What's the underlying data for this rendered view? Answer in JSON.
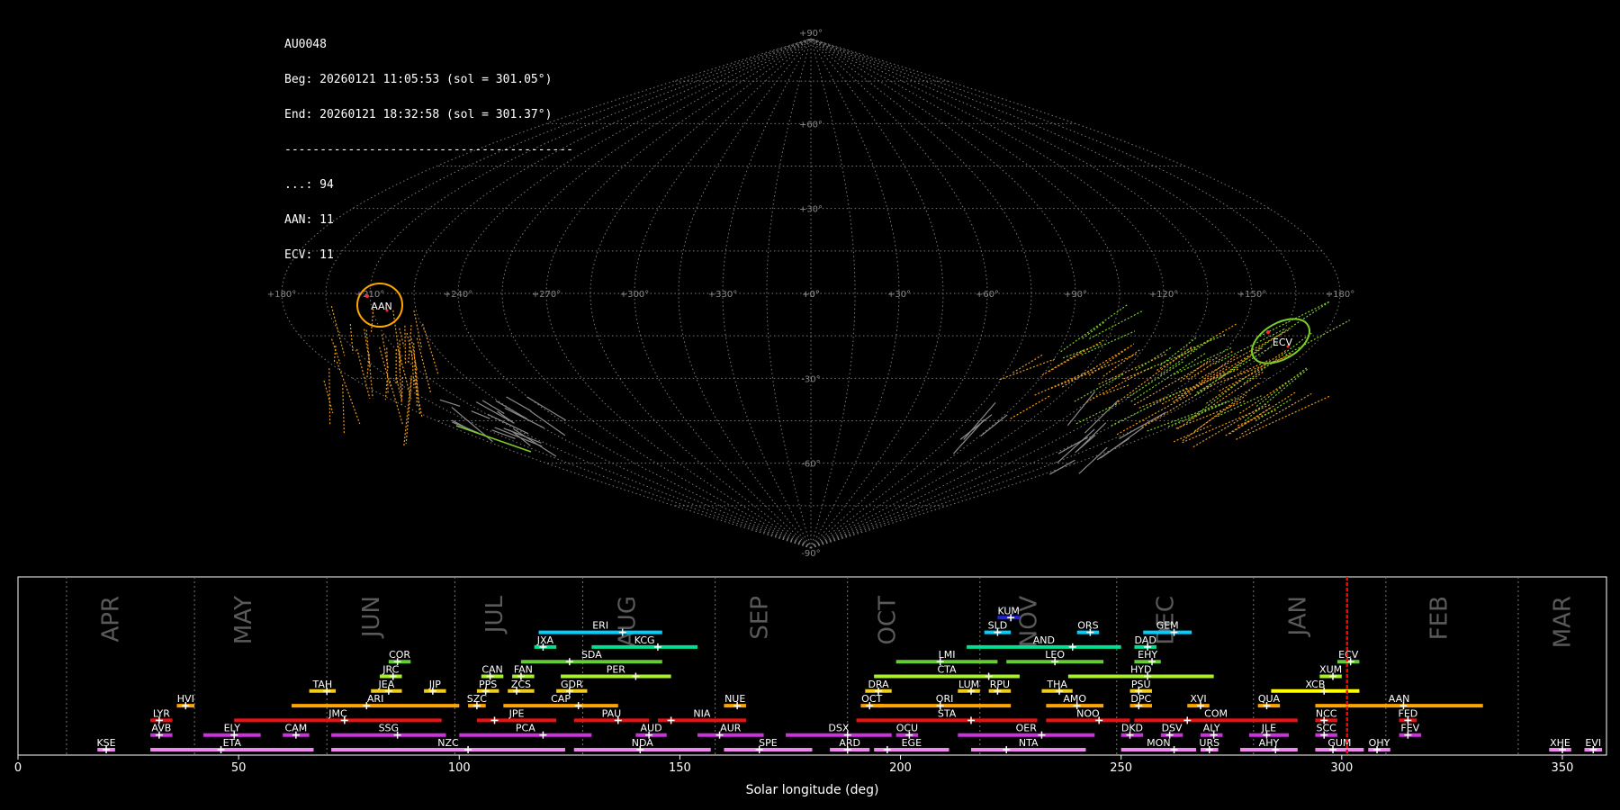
{
  "info": {
    "station": "AU0048",
    "beg": "Beg: 20260121 11:05:53 (sol = 301.05°)",
    "end": "End: 20260121 18:32:58 (sol = 301.37°)",
    "sep": "-----------------------------------------",
    "counts": [
      {
        "label": "...: 94"
      },
      {
        "label": "AAN: 11"
      },
      {
        "label": "ECV: 11"
      }
    ]
  },
  "chart_data": [
    {
      "type": "scatter",
      "projection": "sinusoidal",
      "grid": true,
      "lon_tick_labels": [
        "+180°",
        "+150°",
        "+120°",
        "+90°",
        "+60°",
        "+30°",
        "+0°",
        "+330°",
        "+300°",
        "+270°",
        "+240°",
        "+210°",
        "+180°"
      ],
      "lat_tick_labels": [
        "+90°",
        "+60°",
        "+30°",
        "+0°",
        "-30°",
        "-60°",
        "-90°"
      ],
      "radiants": [
        {
          "name": "AAN",
          "lon": 165,
          "lat": -5,
          "color": "#ffa500"
        },
        {
          "name": "ECV",
          "lon": 206,
          "lat": -17,
          "color": "#7ccd2a"
        }
      ]
    },
    {
      "type": "bar",
      "xlabel": "Solar longitude (deg)",
      "xlim": [
        0,
        360
      ],
      "xticks": [
        0,
        50,
        100,
        150,
        200,
        250,
        300,
        350
      ],
      "current_sol": 301.2,
      "months": [
        {
          "name": "APR",
          "boundary": 11,
          "center": 24
        },
        {
          "name": "MAY",
          "boundary": 40,
          "center": 54
        },
        {
          "name": "JUN",
          "boundary": 70,
          "center": 83
        },
        {
          "name": "JUL",
          "boundary": 99,
          "center": 111
        },
        {
          "name": "AUG",
          "boundary": 128,
          "center": 141
        },
        {
          "name": "SEP",
          "boundary": 158,
          "center": 171
        },
        {
          "name": "OCT",
          "boundary": 188,
          "center": 200
        },
        {
          "name": "NOV",
          "boundary": 218,
          "center": 232
        },
        {
          "name": "DEC",
          "boundary": 249,
          "center": 263
        },
        {
          "name": "JAN",
          "boundary": 280,
          "center": 293
        },
        {
          "name": "FEB",
          "boundary": 310,
          "center": 325
        },
        {
          "name": "MAR",
          "boundary": 340,
          "center": 353
        }
      ],
      "showers": [
        {
          "code": "KUM",
          "start": 222,
          "end": 227,
          "peak": 225,
          "row": 9,
          "color": "#2222dd"
        },
        {
          "code": "ERI",
          "start": 118,
          "end": 146,
          "peak": 137,
          "row": 8,
          "color": "#00d0ff"
        },
        {
          "code": "SLD",
          "start": 219,
          "end": 225,
          "peak": 222,
          "row": 8,
          "color": "#00d0ff"
        },
        {
          "code": "ORS",
          "start": 240,
          "end": 245,
          "peak": 243,
          "row": 8,
          "color": "#00d0ff"
        },
        {
          "code": "GEM",
          "start": 255,
          "end": 266,
          "peak": 262,
          "row": 8,
          "color": "#00d0ff"
        },
        {
          "code": "JXA",
          "start": 117,
          "end": 122,
          "peak": 119,
          "row": 7,
          "color": "#00e090"
        },
        {
          "code": "KCG",
          "start": 130,
          "end": 154,
          "peak": 145,
          "row": 7,
          "color": "#00e090"
        },
        {
          "code": "AND",
          "start": 215,
          "end": 250,
          "peak": 239,
          "row": 7,
          "color": "#00e090"
        },
        {
          "code": "DAD",
          "start": 253,
          "end": 258,
          "peak": 256,
          "row": 7,
          "color": "#00e090"
        },
        {
          "code": "COR",
          "start": 84,
          "end": 89,
          "peak": 86,
          "row": 6,
          "color": "#66cc33"
        },
        {
          "code": "SDA",
          "start": 114,
          "end": 146,
          "peak": 125,
          "row": 6,
          "color": "#66cc33"
        },
        {
          "code": "LMI",
          "start": 199,
          "end": 222,
          "peak": 209,
          "row": 6,
          "color": "#66cc33"
        },
        {
          "code": "LEO",
          "start": 224,
          "end": 246,
          "peak": 235,
          "row": 6,
          "color": "#66cc33"
        },
        {
          "code": "EHY",
          "start": 253,
          "end": 259,
          "peak": 257,
          "row": 6,
          "color": "#66cc33"
        },
        {
          "code": "ECV",
          "start": 299,
          "end": 304,
          "peak": 302,
          "row": 6,
          "color": "#66cc33"
        },
        {
          "code": "JRC",
          "start": 82,
          "end": 87,
          "peak": 85,
          "row": 5,
          "color": "#aaee33"
        },
        {
          "code": "CAN",
          "start": 105,
          "end": 110,
          "peak": 107,
          "row": 5,
          "color": "#aaee33"
        },
        {
          "code": "FAN",
          "start": 112,
          "end": 117,
          "peak": 114,
          "row": 5,
          "color": "#aaee33"
        },
        {
          "code": "PER",
          "start": 123,
          "end": 148,
          "peak": 140,
          "row": 5,
          "color": "#aaee33"
        },
        {
          "code": "CTA",
          "start": 194,
          "end": 227,
          "peak": 220,
          "row": 5,
          "color": "#aaee33"
        },
        {
          "code": "HYD",
          "start": 238,
          "end": 271,
          "peak": 256,
          "row": 5,
          "color": "#aaee33"
        },
        {
          "code": "XUM",
          "start": 295,
          "end": 300,
          "peak": 298,
          "row": 5,
          "color": "#aaee33"
        },
        {
          "code": "TAH",
          "start": 66,
          "end": 72,
          "peak": 70,
          "row": 4,
          "color": "#eecc22"
        },
        {
          "code": "JEA",
          "start": 80,
          "end": 87,
          "peak": 84,
          "row": 4,
          "color": "#eecc22"
        },
        {
          "code": "JIP",
          "start": 92,
          "end": 97,
          "peak": 94,
          "row": 4,
          "color": "#eecc22"
        },
        {
          "code": "PPS",
          "start": 104,
          "end": 109,
          "peak": 106,
          "row": 4,
          "color": "#eecc22"
        },
        {
          "code": "ZCS",
          "start": 111,
          "end": 117,
          "peak": 113,
          "row": 4,
          "color": "#eecc22"
        },
        {
          "code": "GDR",
          "start": 122,
          "end": 129,
          "peak": 125,
          "row": 4,
          "color": "#eecc22"
        },
        {
          "code": "DRA",
          "start": 192,
          "end": 198,
          "peak": 195,
          "row": 4,
          "color": "#eecc22"
        },
        {
          "code": "LUM",
          "start": 213,
          "end": 218,
          "peak": 216,
          "row": 4,
          "color": "#eecc22"
        },
        {
          "code": "RPU",
          "start": 220,
          "end": 225,
          "peak": 222,
          "row": 4,
          "color": "#eecc22"
        },
        {
          "code": "THA",
          "start": 232,
          "end": 239,
          "peak": 236,
          "row": 4,
          "color": "#eecc22"
        },
        {
          "code": "PSU",
          "start": 252,
          "end": 257,
          "peak": 254,
          "row": 4,
          "color": "#eecc22"
        },
        {
          "code": "XCB",
          "start": 284,
          "end": 304,
          "peak": 296,
          "row": 4,
          "color": "#ffff00"
        },
        {
          "code": "HVI",
          "start": 36,
          "end": 40,
          "peak": 38,
          "row": 3,
          "color": "#ffa500"
        },
        {
          "code": "ARI",
          "start": 62,
          "end": 100,
          "peak": 79,
          "row": 3,
          "color": "#ffa500"
        },
        {
          "code": "SZC",
          "start": 102,
          "end": 106,
          "peak": 104,
          "row": 3,
          "color": "#ffa500"
        },
        {
          "code": "CAP",
          "start": 110,
          "end": 136,
          "peak": 127,
          "row": 3,
          "color": "#ffa500"
        },
        {
          "code": "NUE",
          "start": 160,
          "end": 165,
          "peak": 163,
          "row": 3,
          "color": "#ffa500"
        },
        {
          "code": "OCT",
          "start": 191,
          "end": 196,
          "peak": 193,
          "row": 3,
          "color": "#ffa500"
        },
        {
          "code": "ORI",
          "start": 195,
          "end": 225,
          "peak": 209,
          "row": 3,
          "color": "#ffa500"
        },
        {
          "code": "AMO",
          "start": 233,
          "end": 246,
          "peak": 240,
          "row": 3,
          "color": "#ffa500"
        },
        {
          "code": "DPC",
          "start": 252,
          "end": 257,
          "peak": 254,
          "row": 3,
          "color": "#ffa500"
        },
        {
          "code": "XVI",
          "start": 265,
          "end": 270,
          "peak": 268,
          "row": 3,
          "color": "#ffa500"
        },
        {
          "code": "QUA",
          "start": 281,
          "end": 286,
          "peak": 283,
          "row": 3,
          "color": "#ffa500"
        },
        {
          "code": "AAN",
          "start": 294,
          "end": 332,
          "peak": 314,
          "row": 3,
          "color": "#ffa500"
        },
        {
          "code": "LYR",
          "start": 30,
          "end": 35,
          "peak": 32,
          "row": 2,
          "color": "#ee1111"
        },
        {
          "code": "JMC",
          "start": 49,
          "end": 96,
          "peak": 74,
          "row": 2,
          "color": "#ee1111"
        },
        {
          "code": "JPE",
          "start": 104,
          "end": 122,
          "peak": 108,
          "row": 2,
          "color": "#ee1111"
        },
        {
          "code": "PAU",
          "start": 126,
          "end": 143,
          "peak": 136,
          "row": 2,
          "color": "#ee1111"
        },
        {
          "code": "NIA",
          "start": 145,
          "end": 165,
          "peak": 148,
          "row": 2,
          "color": "#ee1111"
        },
        {
          "code": "STA",
          "start": 190,
          "end": 231,
          "peak": 216,
          "row": 2,
          "color": "#ee1111"
        },
        {
          "code": "NOO",
          "start": 233,
          "end": 252,
          "peak": 245,
          "row": 2,
          "color": "#ee1111"
        },
        {
          "code": "COM",
          "start": 253,
          "end": 290,
          "peak": 265,
          "row": 2,
          "color": "#ee1111"
        },
        {
          "code": "NCC",
          "start": 294,
          "end": 299,
          "peak": 296,
          "row": 2,
          "color": "#ee1111"
        },
        {
          "code": "FED",
          "start": 313,
          "end": 317,
          "peak": 315,
          "row": 2,
          "color": "#ee1111"
        },
        {
          "code": "AVB",
          "start": 30,
          "end": 35,
          "peak": 32,
          "row": 1,
          "color": "#cc33dd"
        },
        {
          "code": "ELY",
          "start": 42,
          "end": 55,
          "peak": 49,
          "row": 1,
          "color": "#cc33dd"
        },
        {
          "code": "CAM",
          "start": 60,
          "end": 66,
          "peak": 63,
          "row": 1,
          "color": "#cc33dd"
        },
        {
          "code": "SSG",
          "start": 71,
          "end": 97,
          "peak": 86,
          "row": 1,
          "color": "#cc33dd"
        },
        {
          "code": "PCA",
          "start": 100,
          "end": 130,
          "peak": 119,
          "row": 1,
          "color": "#cc33dd"
        },
        {
          "code": "AUD",
          "start": 140,
          "end": 147,
          "peak": 143,
          "row": 1,
          "color": "#cc33dd"
        },
        {
          "code": "AUR",
          "start": 154,
          "end": 169,
          "peak": 159,
          "row": 1,
          "color": "#cc33dd"
        },
        {
          "code": "DSX",
          "start": 174,
          "end": 198,
          "peak": 188,
          "row": 1,
          "color": "#cc33dd"
        },
        {
          "code": "OCU",
          "start": 199,
          "end": 204,
          "peak": 202,
          "row": 1,
          "color": "#cc33dd"
        },
        {
          "code": "OER",
          "start": 213,
          "end": 244,
          "peak": 232,
          "row": 1,
          "color": "#cc33dd"
        },
        {
          "code": "DKD",
          "start": 250,
          "end": 255,
          "peak": 252,
          "row": 1,
          "color": "#cc33dd"
        },
        {
          "code": "DSV",
          "start": 259,
          "end": 264,
          "peak": 261,
          "row": 1,
          "color": "#cc33dd"
        },
        {
          "code": "ALY",
          "start": 268,
          "end": 273,
          "peak": 271,
          "row": 1,
          "color": "#cc33dd"
        },
        {
          "code": "JLE",
          "start": 279,
          "end": 288,
          "peak": 283,
          "row": 1,
          "color": "#cc33dd"
        },
        {
          "code": "SCC",
          "start": 294,
          "end": 299,
          "peak": 296,
          "row": 1,
          "color": "#cc33dd"
        },
        {
          "code": "FEV",
          "start": 313,
          "end": 318,
          "peak": 315,
          "row": 1,
          "color": "#cc33dd"
        },
        {
          "code": "KSE",
          "start": 18,
          "end": 22,
          "peak": 20,
          "row": 0,
          "color": "#ee88ee"
        },
        {
          "code": "ETA",
          "start": 30,
          "end": 67,
          "peak": 46,
          "row": 0,
          "color": "#ee88ee"
        },
        {
          "code": "NZC",
          "start": 71,
          "end": 124,
          "peak": 102,
          "row": 0,
          "color": "#ee88ee"
        },
        {
          "code": "NDA",
          "start": 126,
          "end": 157,
          "peak": 141,
          "row": 0,
          "color": "#ee88ee"
        },
        {
          "code": "SPE",
          "start": 160,
          "end": 180,
          "peak": 168,
          "row": 0,
          "color": "#ee88ee"
        },
        {
          "code": "ARD",
          "start": 184,
          "end": 193,
          "peak": 188,
          "row": 0,
          "color": "#ee88ee"
        },
        {
          "code": "EGE",
          "start": 194,
          "end": 211,
          "peak": 197,
          "row": 0,
          "color": "#ee88ee"
        },
        {
          "code": "NTA",
          "start": 216,
          "end": 242,
          "peak": 224,
          "row": 0,
          "color": "#ee88ee"
        },
        {
          "code": "MON",
          "start": 250,
          "end": 267,
          "peak": 262,
          "row": 0,
          "color": "#ee88ee"
        },
        {
          "code": "URS",
          "start": 268,
          "end": 272,
          "peak": 270,
          "row": 0,
          "color": "#ee88ee"
        },
        {
          "code": "AHY",
          "start": 277,
          "end": 290,
          "peak": 285,
          "row": 0,
          "color": "#ee88ee"
        },
        {
          "code": "GUM",
          "start": 294,
          "end": 305,
          "peak": 298,
          "row": 0,
          "color": "#ee88ee"
        },
        {
          "code": "OHY",
          "start": 306,
          "end": 311,
          "peak": 308,
          "row": 0,
          "color": "#ee88ee"
        },
        {
          "code": "XHE",
          "start": 347,
          "end": 352,
          "peak": 350,
          "row": 0,
          "color": "#ee88ee"
        },
        {
          "code": "EVI",
          "start": 355,
          "end": 359,
          "peak": 357,
          "row": 0,
          "color": "#ee88ee"
        }
      ]
    }
  ]
}
